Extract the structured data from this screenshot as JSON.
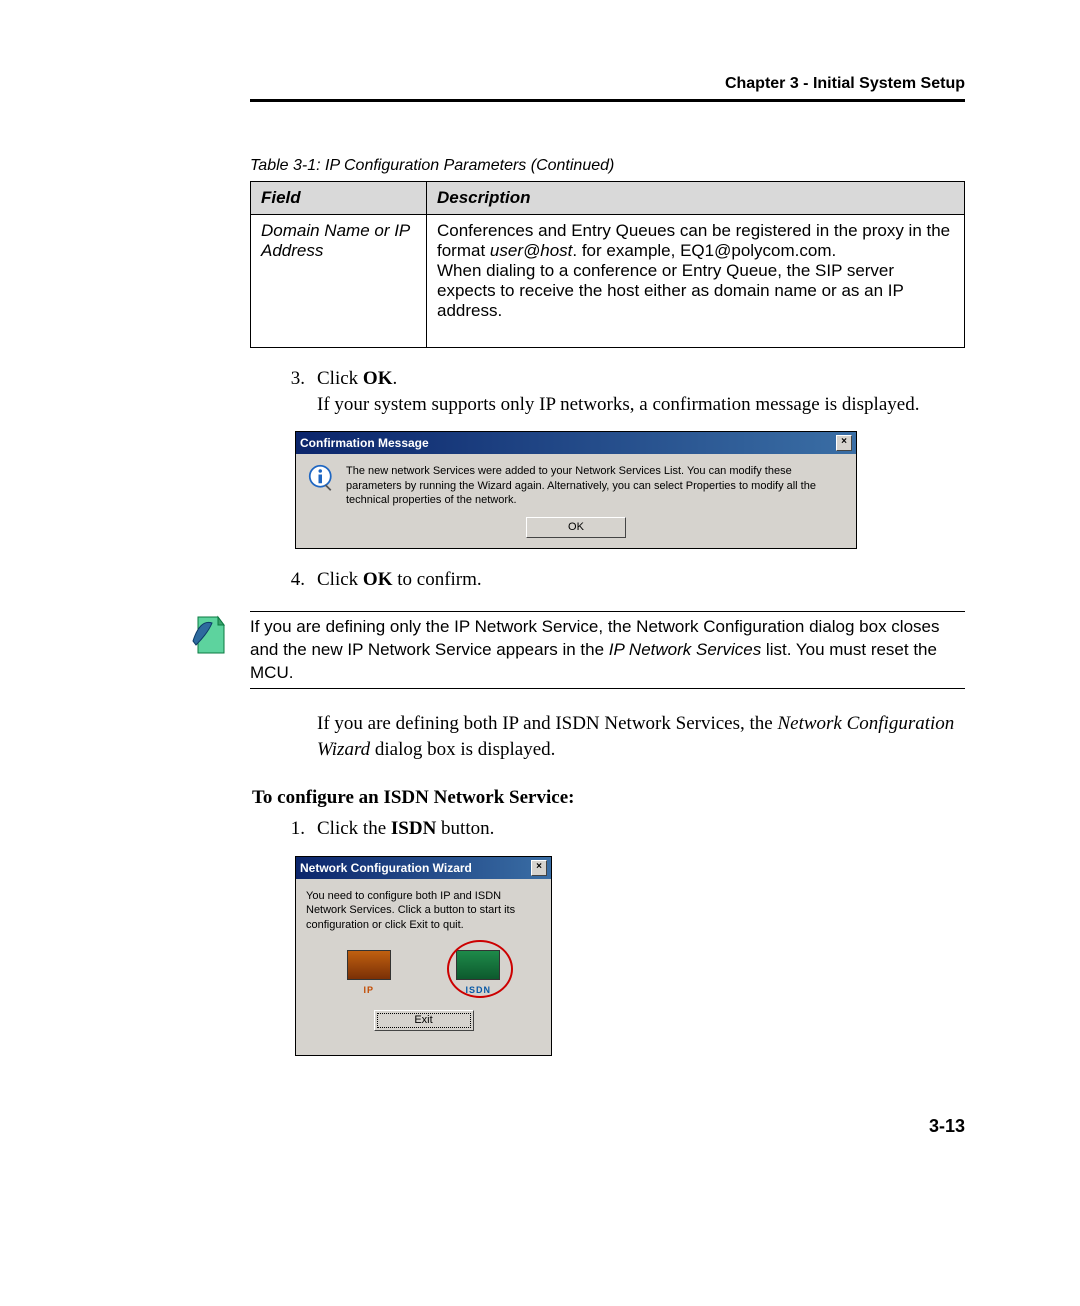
{
  "header": "Chapter 3 - Initial System Setup",
  "table": {
    "caption": "Table 3-1: IP Configuration Parameters (Continued)",
    "header_field": "Field",
    "header_desc": "Description",
    "row": {
      "field": "Domain Name or IP Address",
      "desc_p1a": "Conferences and Entry Queues can be registered in the proxy in the format ",
      "desc_p1b_italic": "user@host",
      "desc_p1c": ". for example, EQ1@polycom.com.",
      "desc_p2": "When dialing to a conference or Entry Queue, the SIP server expects to receive the host either as domain name or as an IP address."
    }
  },
  "step3": {
    "num": "3.",
    "pre": "Click ",
    "bold": "OK",
    "post": ".",
    "line2": "If your system supports only IP networks, a confirmation message is displayed."
  },
  "confirm_dialog": {
    "title": "Confirmation Message",
    "close": "×",
    "msg": "The new network Services were added to your Network Services List. You can modify these parameters by running the Wizard again. Alternatively, you can select Properties to modify all the technical properties of the network.",
    "ok": "OK"
  },
  "step4": {
    "num": "4.",
    "pre": "Click ",
    "bold": "OK",
    "post": " to confirm."
  },
  "note": {
    "p1": "If you are defining only the IP Network Service, the Network Configuration dialog box closes and the new IP Network Service appears in the ",
    "italic": "IP Network Services",
    "p2": " list. You must reset the MCU."
  },
  "after_note": {
    "p1": "If you are defining both IP and ISDN Network Services, the ",
    "italic": "Network Configuration Wizard",
    "p2": " dialog box is displayed."
  },
  "isdn_section": {
    "heading": "To configure an ISDN Network Service:",
    "step1_num": "1.",
    "step1_pre": "Click the ",
    "step1_bold": "ISDN",
    "step1_post": " button."
  },
  "wizard_dialog": {
    "title": "Network Configuration Wizard",
    "close": "×",
    "msg": "You need to configure both IP and ISDN Network Services. Click a button to start its configuration or click Exit to quit.",
    "ip_label": "IP",
    "isdn_label": "ISDN",
    "exit": "Exit"
  },
  "pagenum": "3-13"
}
